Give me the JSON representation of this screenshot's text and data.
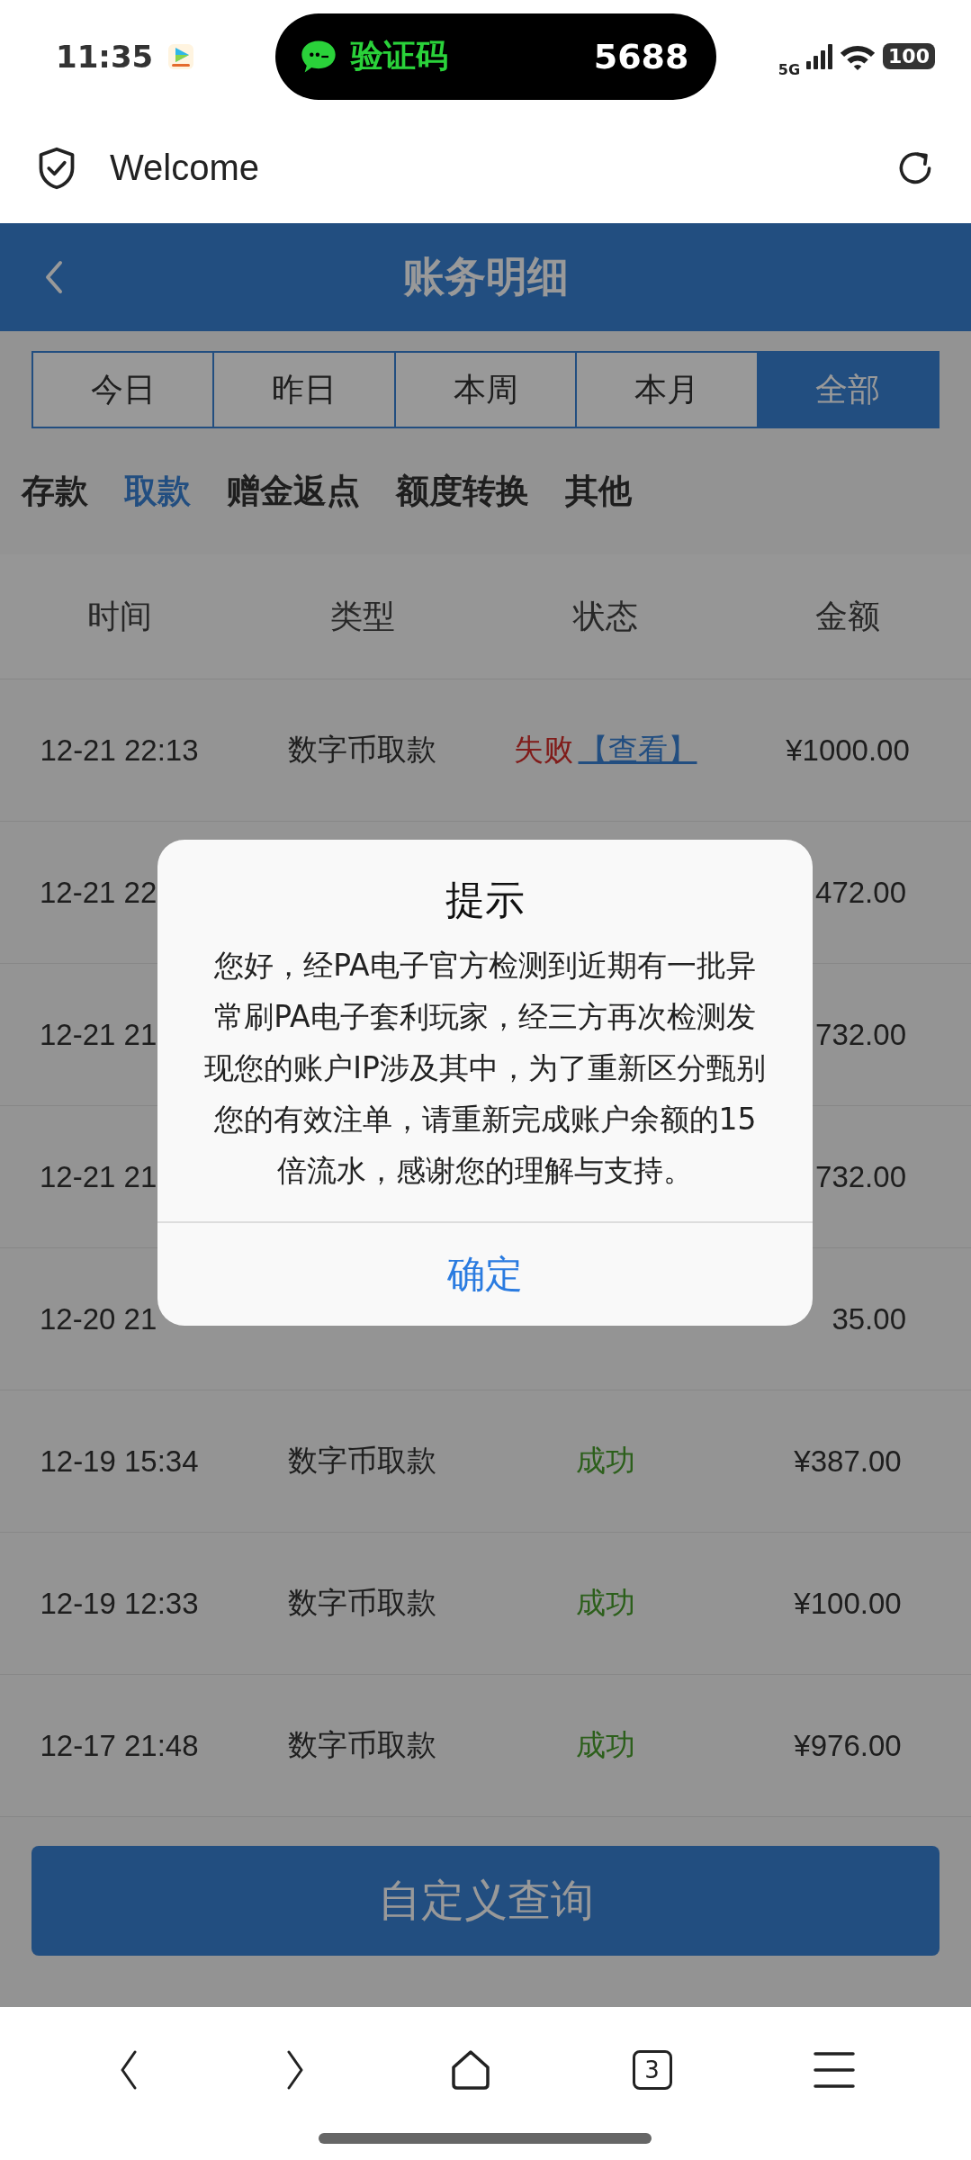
{
  "status_bar": {
    "time": "11:35",
    "notification": {
      "label": "验证码",
      "code": "5688"
    },
    "network": "5G",
    "battery": "100"
  },
  "browser_bar": {
    "title": "Welcome"
  },
  "header": {
    "title": "账务明细"
  },
  "date_tabs": [
    {
      "label": "今日",
      "selected": false
    },
    {
      "label": "昨日",
      "selected": false
    },
    {
      "label": "本周",
      "selected": false
    },
    {
      "label": "本月",
      "selected": false
    },
    {
      "label": "全部",
      "selected": true
    }
  ],
  "categories": [
    {
      "label": "存款",
      "selected": false
    },
    {
      "label": "取款",
      "selected": true
    },
    {
      "label": "赠金返点",
      "selected": false
    },
    {
      "label": "额度转换",
      "selected": false
    },
    {
      "label": "其他",
      "selected": false
    }
  ],
  "table": {
    "columns": [
      "时间",
      "类型",
      "状态",
      "金额"
    ],
    "rows": [
      {
        "time": "12-21 22:13",
        "type": "数字币取款",
        "status": "失败",
        "kind": "failed",
        "link": "【查看】",
        "amount": "¥1000.00"
      },
      {
        "time": "12-21 22",
        "amount": "472.00"
      },
      {
        "time": "12-21 21",
        "amount": "732.00"
      },
      {
        "time": "12-21 21",
        "amount": "732.00"
      },
      {
        "time": "12-20 21",
        "amount": "35.00"
      },
      {
        "time": "12-19 15:34",
        "type": "数字币取款",
        "status": "成功",
        "kind": "success",
        "amount": "¥387.00"
      },
      {
        "time": "12-19 12:33",
        "type": "数字币取款",
        "status": "成功",
        "kind": "success",
        "amount": "¥100.00"
      },
      {
        "time": "12-17 21:48",
        "type": "数字币取款",
        "status": "成功",
        "kind": "success",
        "amount": "¥976.00"
      }
    ]
  },
  "query_button": "自定义查询",
  "dialog": {
    "title": "提示",
    "message": "您好，经PA电子官方检测到近期有一批异常刷PA电子套利玩家，经三方再次检测发现您的账户IP涉及其中，为了重新区分甄别您的有效注单，请重新完成账户余额的15倍流水，感谢您的理解与支持。",
    "confirm": "确定"
  },
  "bottom_nav": {
    "tab_count": "3"
  }
}
